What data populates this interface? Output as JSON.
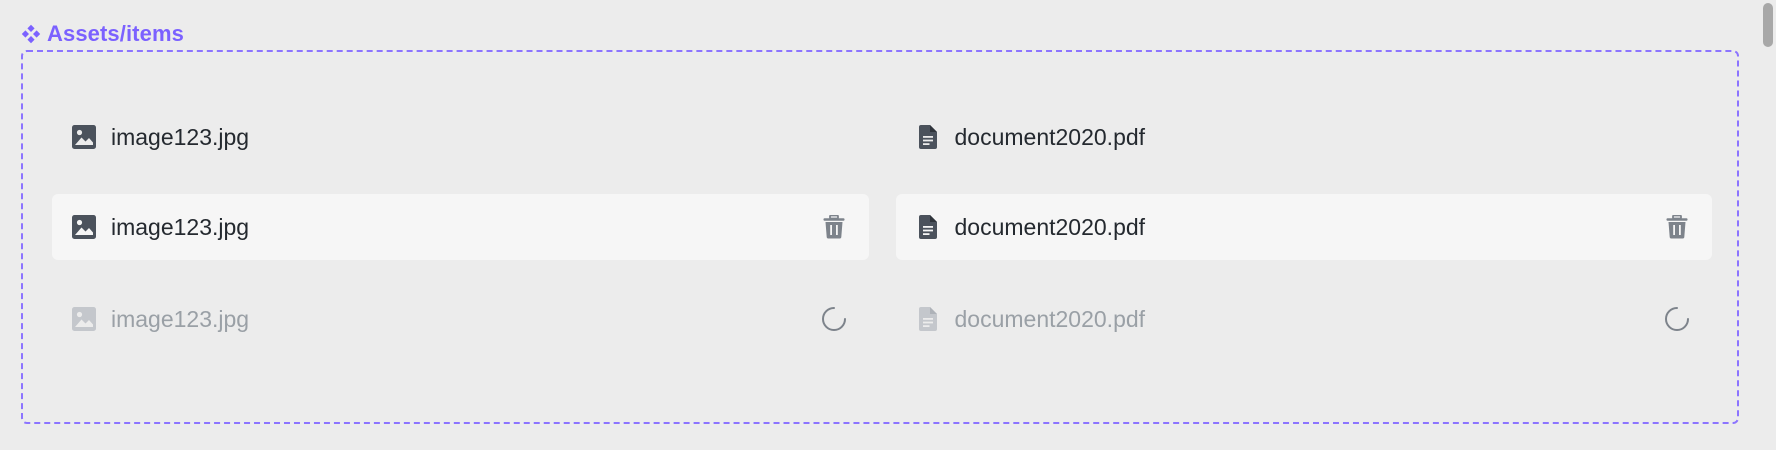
{
  "section": {
    "title": "Assets/items",
    "accent_color": "#7b61ff",
    "icon": "component-icon"
  },
  "rows": [
    {
      "state": "default",
      "items": [
        {
          "name": "image123.jpg",
          "type_icon": "image-icon"
        },
        {
          "name": "document2020.pdf",
          "type_icon": "document-icon"
        }
      ]
    },
    {
      "state": "hover",
      "items": [
        {
          "name": "image123.jpg",
          "type_icon": "image-icon",
          "action_icon": "trash-icon"
        },
        {
          "name": "document2020.pdf",
          "type_icon": "document-icon",
          "action_icon": "trash-icon"
        }
      ]
    },
    {
      "state": "loading",
      "items": [
        {
          "name": "image123.jpg",
          "type_icon": "image-icon",
          "action_icon": "spinner-icon"
        },
        {
          "name": "document2020.pdf",
          "type_icon": "document-icon",
          "action_icon": "spinner-icon"
        }
      ]
    }
  ],
  "colors": {
    "text": "#24292f",
    "text_muted": "#9aa0a6",
    "icon": "#4b525c",
    "icon_muted": "#c4c7cc",
    "hover_bg": "#f6f6f6",
    "frame_border": "#8c74ff"
  }
}
